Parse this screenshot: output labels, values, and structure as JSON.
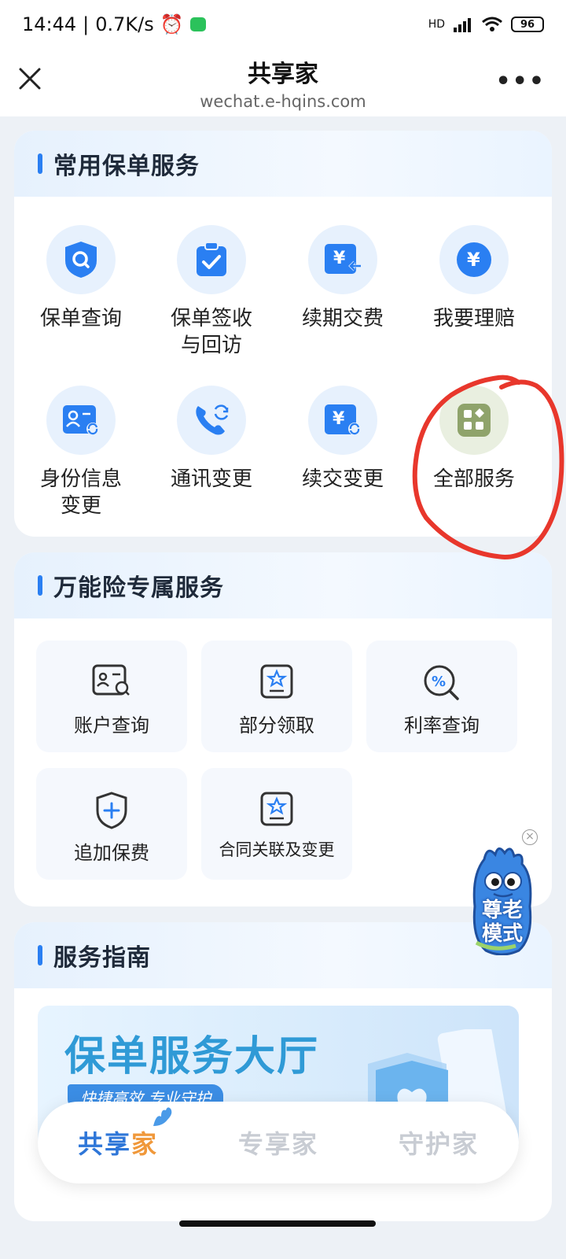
{
  "status_bar": {
    "time": "14:44",
    "speed": "0.7K/s",
    "battery": "96",
    "network": "HD"
  },
  "nav": {
    "title": "共享家",
    "url": "wechat.e-hqins.com"
  },
  "common_services": {
    "title": "常用保单服务",
    "items": [
      {
        "label": "保单查询",
        "icon": "shield-search-icon"
      },
      {
        "label": "保单签收\n与回访",
        "icon": "clipboard-check-icon"
      },
      {
        "label": "续期交费",
        "icon": "yen-card-icon"
      },
      {
        "label": "我要理赔",
        "icon": "yen-circle-icon"
      },
      {
        "label": "身份信息\n变更",
        "icon": "id-card-refresh-icon"
      },
      {
        "label": "通讯变更",
        "icon": "phone-refresh-icon"
      },
      {
        "label": "续交变更",
        "icon": "yen-refresh-icon"
      },
      {
        "label": "全部服务",
        "icon": "grid-apps-icon"
      }
    ]
  },
  "universal_services": {
    "title": "万能险专属服务",
    "items": [
      {
        "label": "账户查询",
        "icon": "account-search-icon"
      },
      {
        "label": "部分领取",
        "icon": "badge-star-icon"
      },
      {
        "label": "利率查询",
        "icon": "percent-search-icon"
      },
      {
        "label": "追加保费",
        "icon": "shield-plus-icon"
      },
      {
        "label": "合同关联及变更",
        "icon": "badge-star-icon"
      }
    ]
  },
  "guide": {
    "title": "服务指南",
    "banner_title": "保单服务大厅",
    "banner_sub": "快捷高效 专业守护"
  },
  "elder_mode": {
    "label_line1": "尊老",
    "label_line2": "模式"
  },
  "tabs": [
    {
      "label_main": "共享",
      "label_accent": "家",
      "active": true
    },
    {
      "label_main": "专享家",
      "label_accent": "",
      "active": false
    },
    {
      "label_main": "守护家",
      "label_accent": "",
      "active": false
    }
  ],
  "colors": {
    "accent_blue": "#2a7ff2",
    "annotation_red": "#e8372c",
    "tab_active": "#2e76d8",
    "tab_accent": "#f0983a"
  }
}
